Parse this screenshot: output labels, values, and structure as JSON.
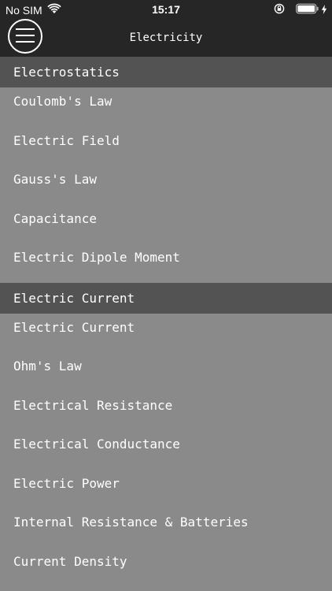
{
  "status_bar": {
    "carrier": "No SIM",
    "time": "15:17",
    "icons": [
      "wifi-icon",
      "orientation-lock-icon",
      "battery-icon",
      "charging-bolt-icon"
    ]
  },
  "nav": {
    "title": "Electricity",
    "menu_icon": "hamburger-menu-icon"
  },
  "sections": [
    {
      "header": "Electrostatics",
      "items": [
        "Coulomb's Law",
        "Electric Field",
        "Gauss's Law",
        "Capacitance",
        "Electric Dipole Moment"
      ]
    },
    {
      "header": "Electric Current",
      "items": [
        "Electric Current",
        "Ohm's Law",
        "Electrical Resistance",
        "Electrical Conductance",
        "Electric Power",
        "Internal Resistance & Batteries",
        "Current Density"
      ]
    }
  ],
  "colors": {
    "bar_background": "#262626",
    "section_header": "#535353",
    "list_background": "#8a8a8a",
    "text": "#ffffff"
  }
}
